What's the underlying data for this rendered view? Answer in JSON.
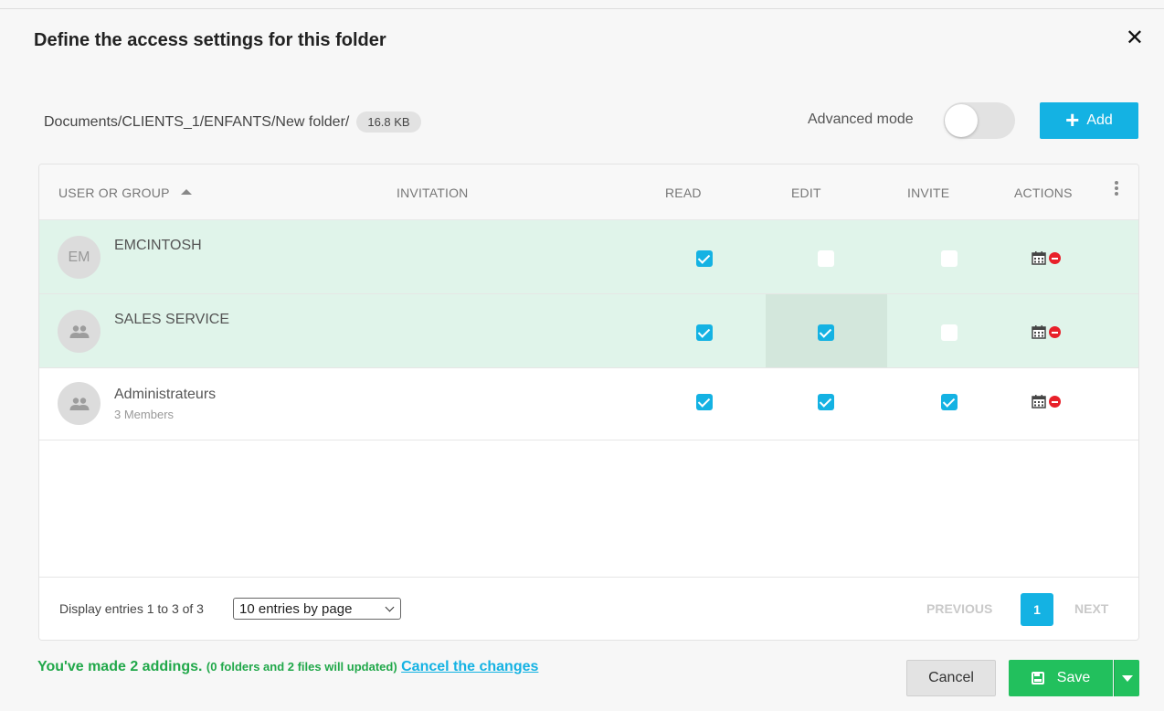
{
  "dialog": {
    "title": "Define the access settings for this folder",
    "close_glyph": "✕"
  },
  "folder": {
    "path": "Documents/CLIENTS_1/ENFANTS/New folder/",
    "size": "16.8 KB"
  },
  "toolbar": {
    "advanced_mode_label": "Advanced mode",
    "advanced_mode_on": false,
    "add_label": "Add"
  },
  "table": {
    "columns": {
      "user": "USER OR GROUP",
      "invitation": "INVITATION",
      "read": "READ",
      "edit": "EDIT",
      "invite": "INVITE",
      "actions": "ACTIONS"
    },
    "rows": [
      {
        "initials": "EM",
        "name": "EMCINTOSH",
        "members": "",
        "read": true,
        "edit": false,
        "invite": false,
        "highlight": "added"
      },
      {
        "initials": "",
        "name": "SALES SERVICE",
        "members": "",
        "read": true,
        "edit": true,
        "invite": false,
        "highlight": "added"
      },
      {
        "initials": "",
        "name": "Administrateurs",
        "members": "3 Members",
        "read": true,
        "edit": true,
        "invite": true,
        "highlight": "none"
      }
    ]
  },
  "pagination": {
    "display_text": "Display entries 1 to 3 of 3",
    "page_size_option": "10 entries by page",
    "previous_label": "PREVIOUS",
    "current_page": "1",
    "next_label": "NEXT"
  },
  "footer": {
    "message_main": "You've made 2 addings.",
    "message_detail": "(0 folders and 2 files will updated)",
    "cancel_link": "Cancel the changes",
    "cancel_button": "Cancel",
    "save_button": "Save"
  },
  "colors": {
    "accent": "#14b2e3",
    "save_green": "#22c05d",
    "row_added": "#e0f4ea",
    "message_green": "#21a84a",
    "delete_red": "#e8202a"
  }
}
